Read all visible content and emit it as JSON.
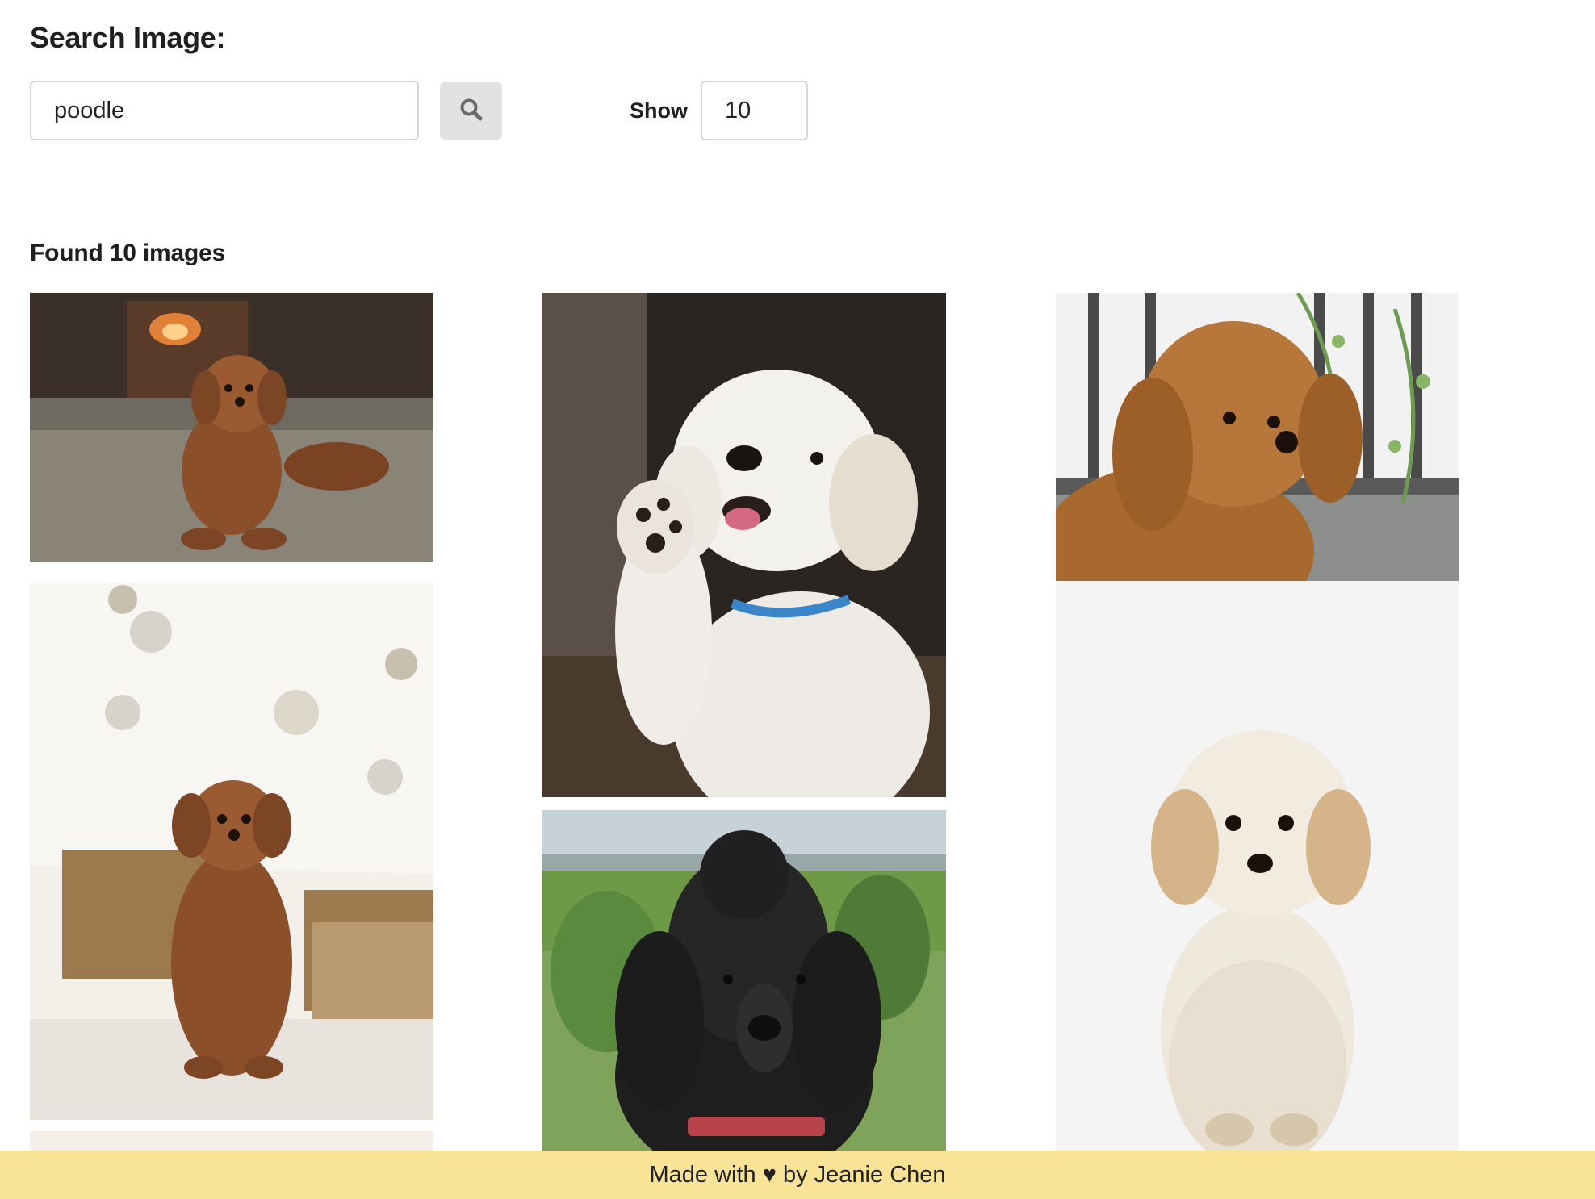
{
  "search": {
    "title": "Search Image:",
    "query_value": "poodle",
    "search_button_icon": "search-icon",
    "show_label": "Show",
    "show_value": "10"
  },
  "results": {
    "found_text": "Found 10 images",
    "images": [
      {
        "subject": "brown toy poodle lying on carpet by fireplace"
      },
      {
        "subject": "white poodle raising paw"
      },
      {
        "subject": "apricot poodle by window railing"
      },
      {
        "subject": "brown poodle sitting under white christmas tree"
      },
      {
        "subject": "black standard poodle outdoors"
      },
      {
        "subject": "cream poodle puppy on white background"
      },
      {
        "subject": "partially visible image"
      }
    ]
  },
  "footer": {
    "text": "Made with ♥ by Jeanie Chen"
  },
  "colors": {
    "footer_bg": "#f9e397",
    "button_bg": "#e2e2e2",
    "input_border": "#d6d6d6"
  }
}
